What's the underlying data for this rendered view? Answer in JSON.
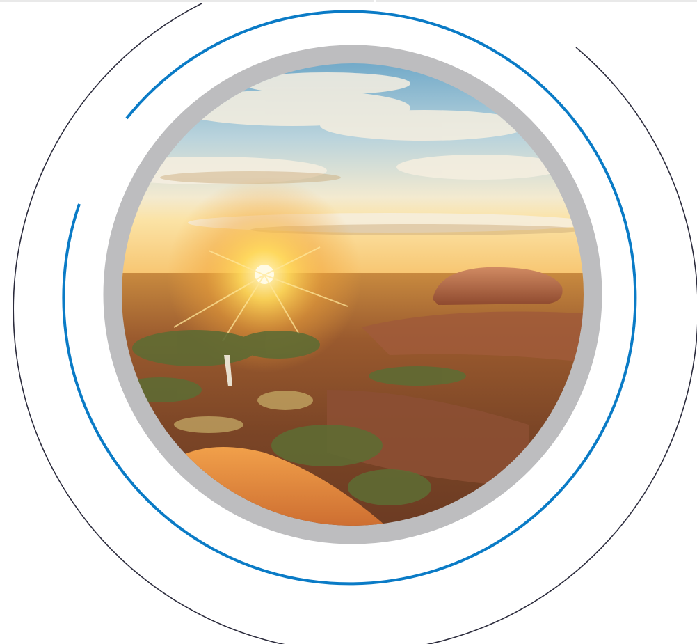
{
  "colors": {
    "background": "#ffffff",
    "outer_ring": "#2b2b3c",
    "accent_ring": "#0a7bc6",
    "frame_ring": "#bdbdbf",
    "sky_top": "#7fb3cf",
    "sky_low": "#f4e7c2",
    "sun": "#ffd95a",
    "ground": "#a2582c",
    "rock": "#b8674a",
    "grass": "#6f7a3a"
  },
  "icons": {
    "photo": "outback-sunset-photo"
  }
}
